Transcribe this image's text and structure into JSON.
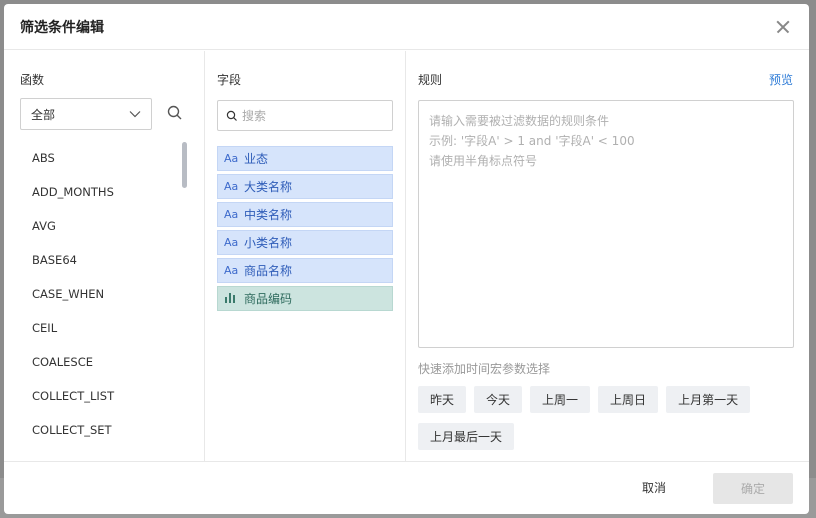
{
  "dialog": {
    "title": "筛选条件编辑"
  },
  "functions": {
    "label": "函数",
    "select_value": "全部",
    "items": [
      "ABS",
      "ADD_MONTHS",
      "AVG",
      "BASE64",
      "CASE_WHEN",
      "CEIL",
      "COALESCE",
      "COLLECT_LIST",
      "COLLECT_SET"
    ]
  },
  "fields": {
    "label": "字段",
    "search_placeholder": "搜索",
    "items": [
      {
        "type_icon": "Aa",
        "name": "业态",
        "kind": "dimension"
      },
      {
        "type_icon": "Aa",
        "name": "大类名称",
        "kind": "dimension"
      },
      {
        "type_icon": "Aa",
        "name": "中类名称",
        "kind": "dimension"
      },
      {
        "type_icon": "Aa",
        "name": "小类名称",
        "kind": "dimension"
      },
      {
        "type_icon": "Aa",
        "name": "商品名称",
        "kind": "dimension"
      },
      {
        "type_icon": "bar-chart-icon",
        "name": "商品编码",
        "kind": "measure"
      }
    ]
  },
  "rule": {
    "label": "规则",
    "preview": "预览",
    "placeholder_lines": [
      "请输入需要被过滤数据的规则条件",
      "示例: '字段A' > 1 and '字段A' < 100",
      "请使用半角标点符号"
    ],
    "macro_label": "快速添加时间宏参数选择",
    "macros": [
      "昨天",
      "今天",
      "上周一",
      "上周日",
      "上月第一天",
      "上月最后一天"
    ]
  },
  "footer": {
    "cancel": "取消",
    "confirm": "确定"
  },
  "colors": {
    "accent": "#2d7bd6",
    "dimension_bg": "#d6e4fb",
    "measure_bg": "#cce4df"
  }
}
